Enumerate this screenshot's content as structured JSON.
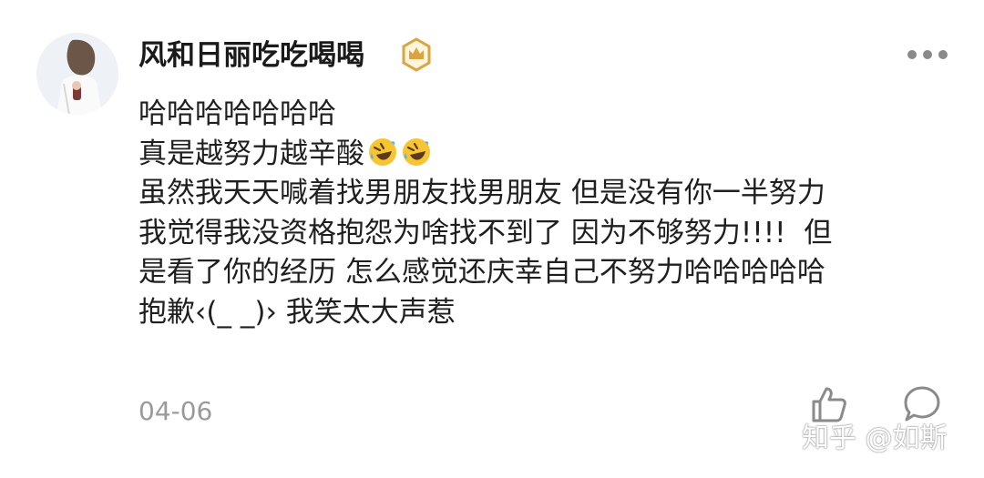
{
  "comment": {
    "username": "风和日丽吃吃喝喝",
    "badge_icon": "crown-badge-icon",
    "more_icon": "more-dots-icon",
    "lines": [
      "哈哈哈哈哈哈哈",
      "真是越努力越辛酸",
      "虽然我天天喊着找男朋友找男朋友 但是没有你一半努力",
      "我觉得我没资格抱怨为啥找不到了 因为不够努力!!!!  但",
      "是看了你的经历 怎么感觉还庆幸自己不努力哈哈哈哈哈",
      "抱歉‹(_ _)› 我笑太大声惹"
    ],
    "emojis": [
      "rolling-laughing-emoji",
      "rolling-laughing-emoji"
    ],
    "date": "04-06",
    "like_icon": "thumbs-up-icon",
    "comment_icon": "comment-bubble-icon"
  },
  "watermark": "知乎 @如斯",
  "colors": {
    "username": "#1a1a1a",
    "text": "#1f1f1f",
    "date": "#9a9a9a",
    "icon": "#8a8a8a",
    "badge_gold": "#d9a441",
    "emoji_yellow": "#f7c531"
  }
}
